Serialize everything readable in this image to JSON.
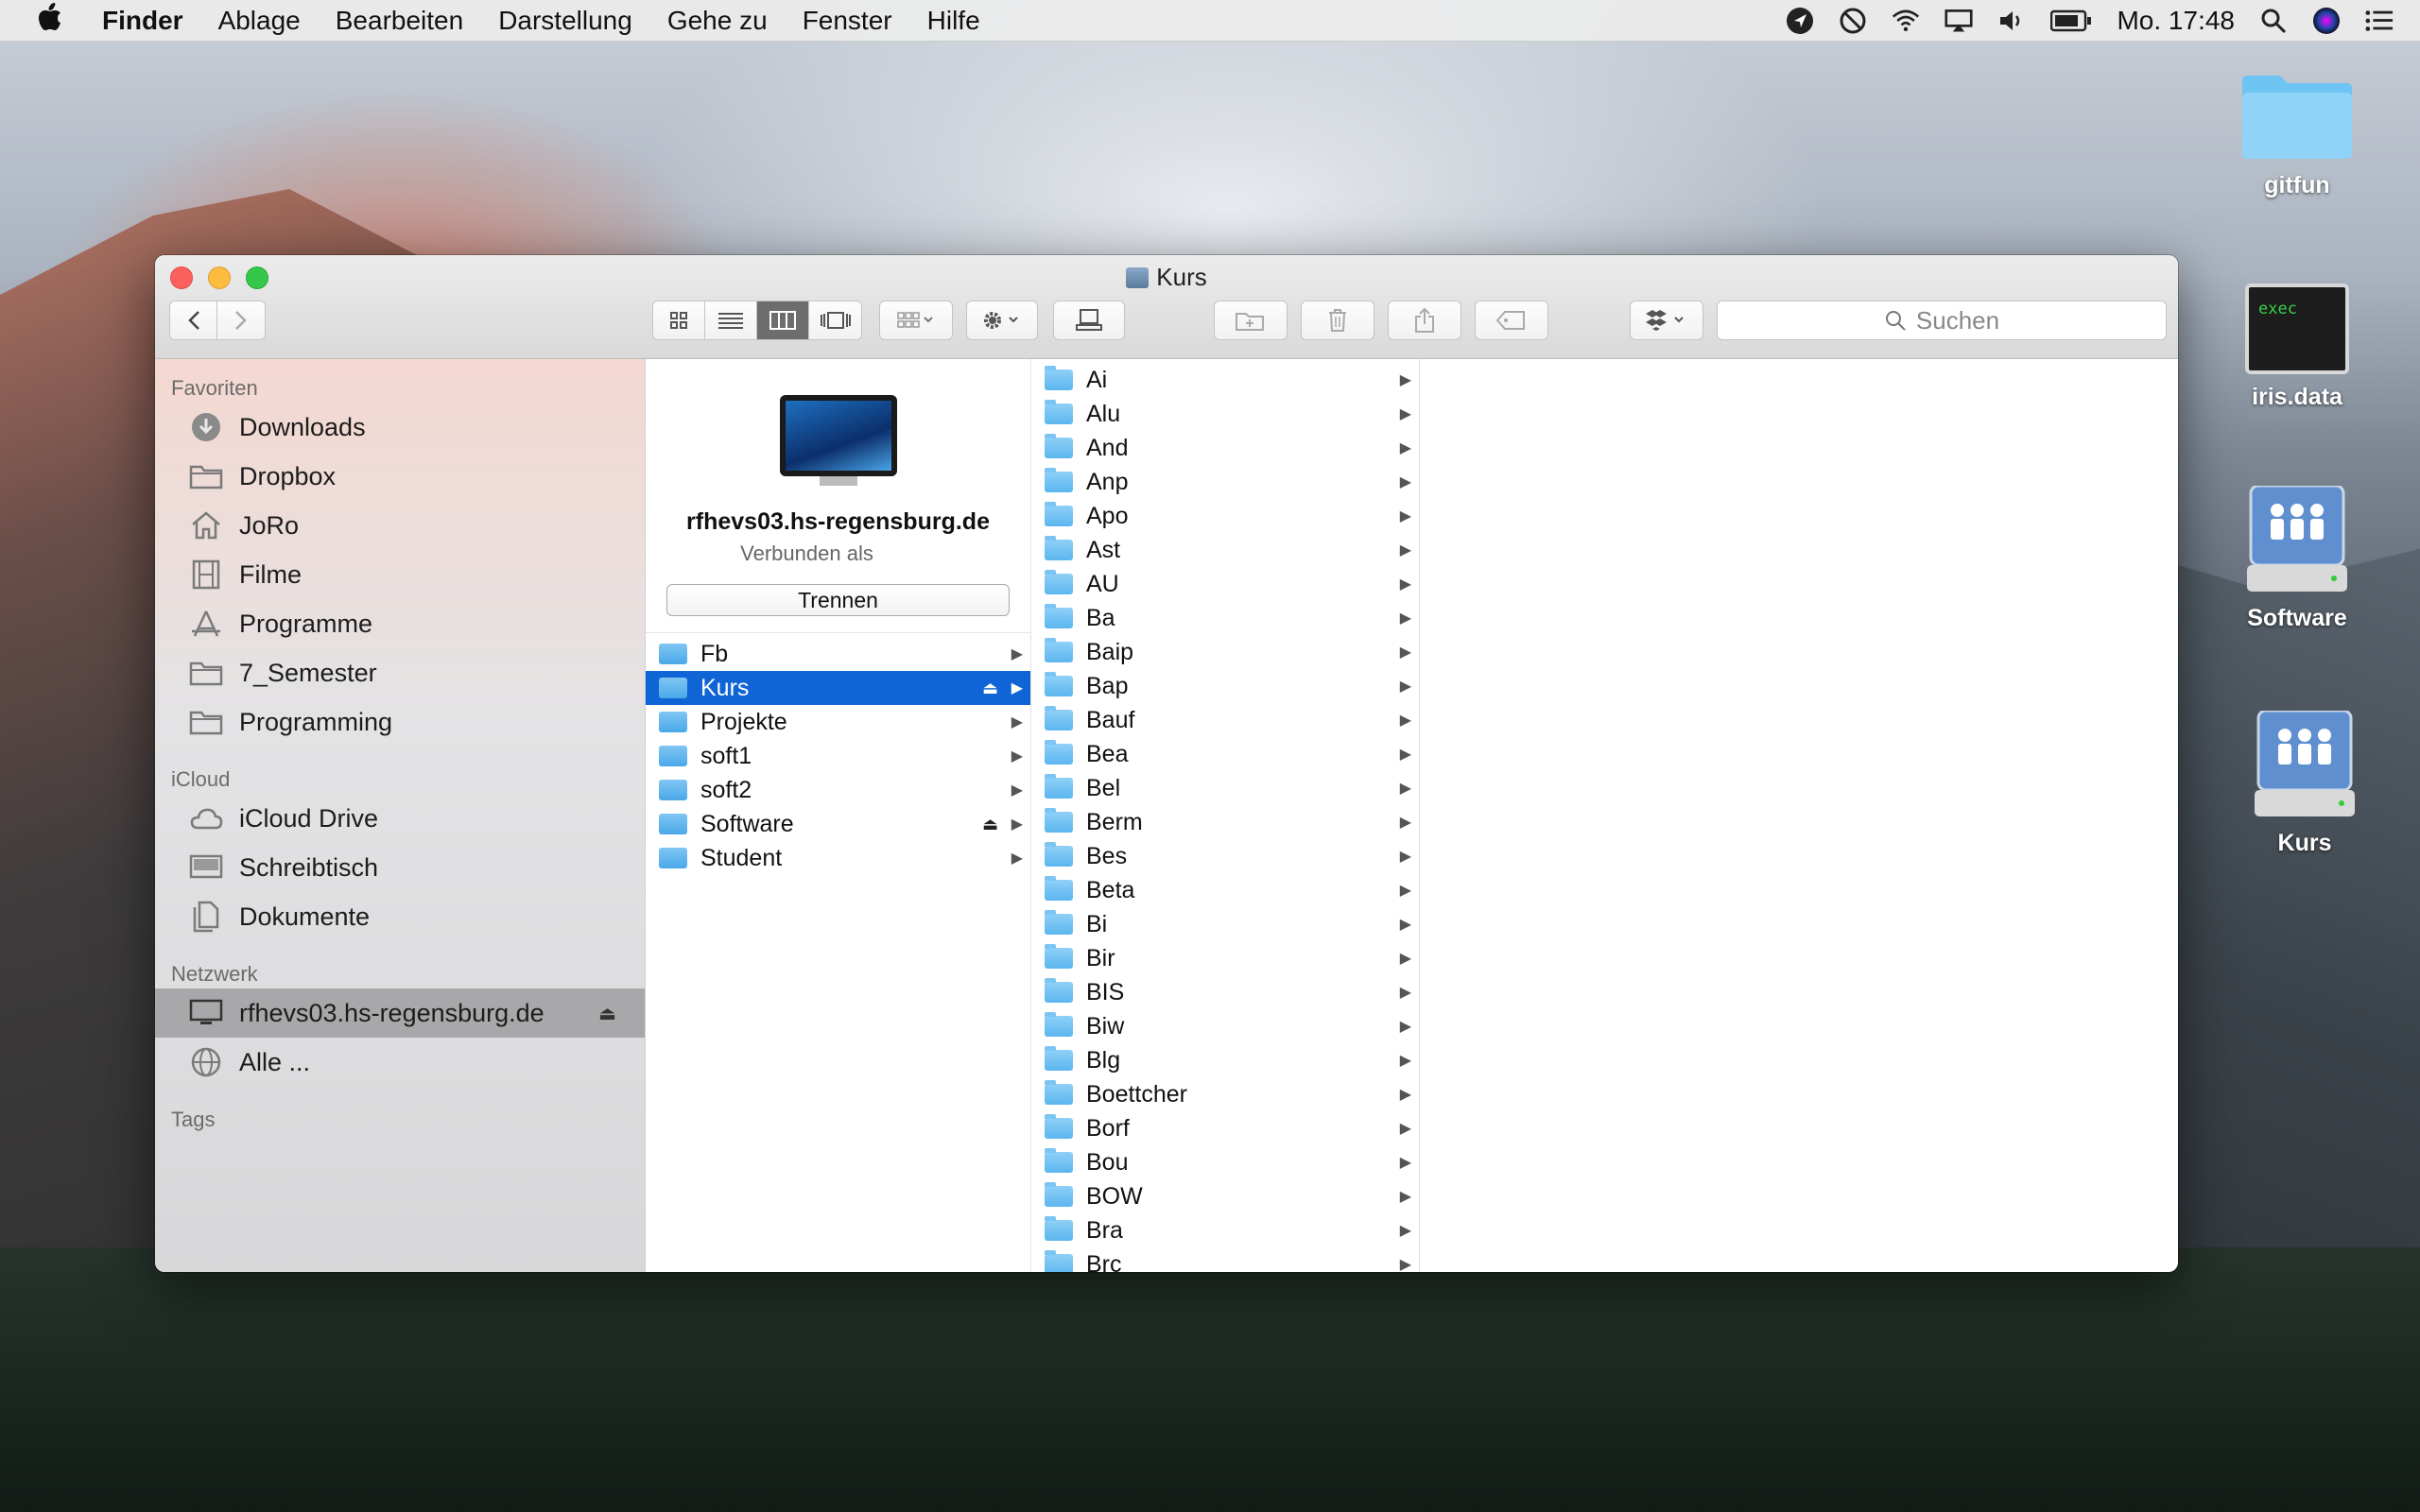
{
  "menubar": {
    "app": "Finder",
    "items": [
      "Ablage",
      "Bearbeiten",
      "Darstellung",
      "Gehe zu",
      "Fenster",
      "Hilfe"
    ],
    "clock": "Mo. 17:48"
  },
  "desktop": {
    "icons": [
      {
        "label": "gitfun"
      },
      {
        "label": "iris.data",
        "badge": "exec"
      },
      {
        "label": "Software"
      },
      {
        "label": "Kurs"
      }
    ]
  },
  "window": {
    "title": "Kurs",
    "search_placeholder": "Suchen"
  },
  "sidebar": {
    "sections": [
      {
        "heading": "Favoriten",
        "items": [
          "Downloads",
          "Dropbox",
          "JoRo",
          "Filme",
          "Programme",
          "7_Semester",
          "Programming"
        ]
      },
      {
        "heading": "iCloud",
        "items": [
          "iCloud Drive",
          "Schreibtisch",
          "Dokumente"
        ]
      },
      {
        "heading": "Netzwerk",
        "items": [
          "rfhevs03.hs-regensburg.de",
          "Alle ..."
        ]
      },
      {
        "heading": "Tags",
        "items": []
      }
    ],
    "selected": "rfhevs03.hs-regensburg.de"
  },
  "server": {
    "name": "rfhevs03.hs-regensburg.de",
    "connected_as": "Verbunden als",
    "disconnect_label": "Trennen"
  },
  "column1": {
    "items": [
      "Fb",
      "Kurs",
      "Projekte",
      "soft1",
      "soft2",
      "Software",
      "Student"
    ],
    "selected": "Kurs",
    "mounted": [
      "Kurs",
      "Software"
    ]
  },
  "column2": {
    "items": [
      "Ai",
      "Alu",
      "And",
      "Anp",
      "Apo",
      "Ast",
      "AU",
      "Ba",
      "Baip",
      "Bap",
      "Bauf",
      "Bea",
      "Bel",
      "Berm",
      "Bes",
      "Beta",
      "Bi",
      "Bir",
      "BIS",
      "Biw",
      "Blg",
      "Boettcher",
      "Borf",
      "Bou",
      "BOW",
      "Bra",
      "Brc"
    ]
  }
}
